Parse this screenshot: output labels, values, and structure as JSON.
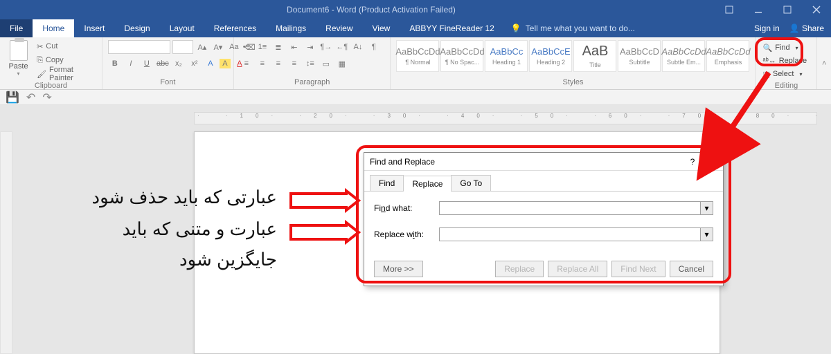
{
  "window": {
    "title": "Document6 - Word (Product Activation Failed)",
    "help_text": "Tell me what you want to do...",
    "sign_in": "Sign in",
    "share": "Share"
  },
  "menu": {
    "file": "File",
    "home": "Home",
    "insert": "Insert",
    "design": "Design",
    "layout": "Layout",
    "references": "References",
    "mailings": "Mailings",
    "review": "Review",
    "view": "View",
    "finereader": "ABBYY FineReader 12"
  },
  "ribbon": {
    "clipboard": {
      "label": "Clipboard",
      "paste": "Paste",
      "cut": "Cut",
      "copy": "Copy",
      "format_painter": "Format Painter"
    },
    "font": {
      "label": "Font",
      "placeholder_font": "",
      "placeholder_size": ""
    },
    "paragraph": {
      "label": "Paragraph"
    },
    "styles": {
      "label": "Styles",
      "items": [
        {
          "sample": "AaBbCcDd",
          "name": "¶ Normal"
        },
        {
          "sample": "AaBbCcDd",
          "name": "¶ No Spac..."
        },
        {
          "sample": "AaBbCc",
          "name": "Heading 1"
        },
        {
          "sample": "AaBbCcE",
          "name": "Heading 2"
        },
        {
          "sample": "AaB",
          "name": "Title"
        },
        {
          "sample": "AaBbCcD",
          "name": "Subtitle"
        },
        {
          "sample": "AaBbCcDd",
          "name": "Subtle Em..."
        },
        {
          "sample": "AaBbCcDd",
          "name": "Emphasis"
        }
      ]
    },
    "editing": {
      "label": "Editing",
      "find": "Find",
      "replace": "Replace",
      "select": "Select"
    }
  },
  "dialog": {
    "title": "Find and Replace",
    "tabs": {
      "find": "Find",
      "replace": "Replace",
      "goto": "Go To"
    },
    "find_what": "Find what:",
    "replace_with": "Replace with:",
    "find_value": "",
    "replace_value": "",
    "more": "More >>",
    "btn_replace": "Replace",
    "btn_replace_all": "Replace All",
    "btn_find_next": "Find Next",
    "btn_cancel": "Cancel"
  },
  "annotations": {
    "line1": "عبارتی که باید حذف شود",
    "line2": "عبارت و متنی که باید",
    "line3": "جایگزین شود"
  },
  "colors": {
    "accent": "#2b579a",
    "annotation": "#e11"
  }
}
